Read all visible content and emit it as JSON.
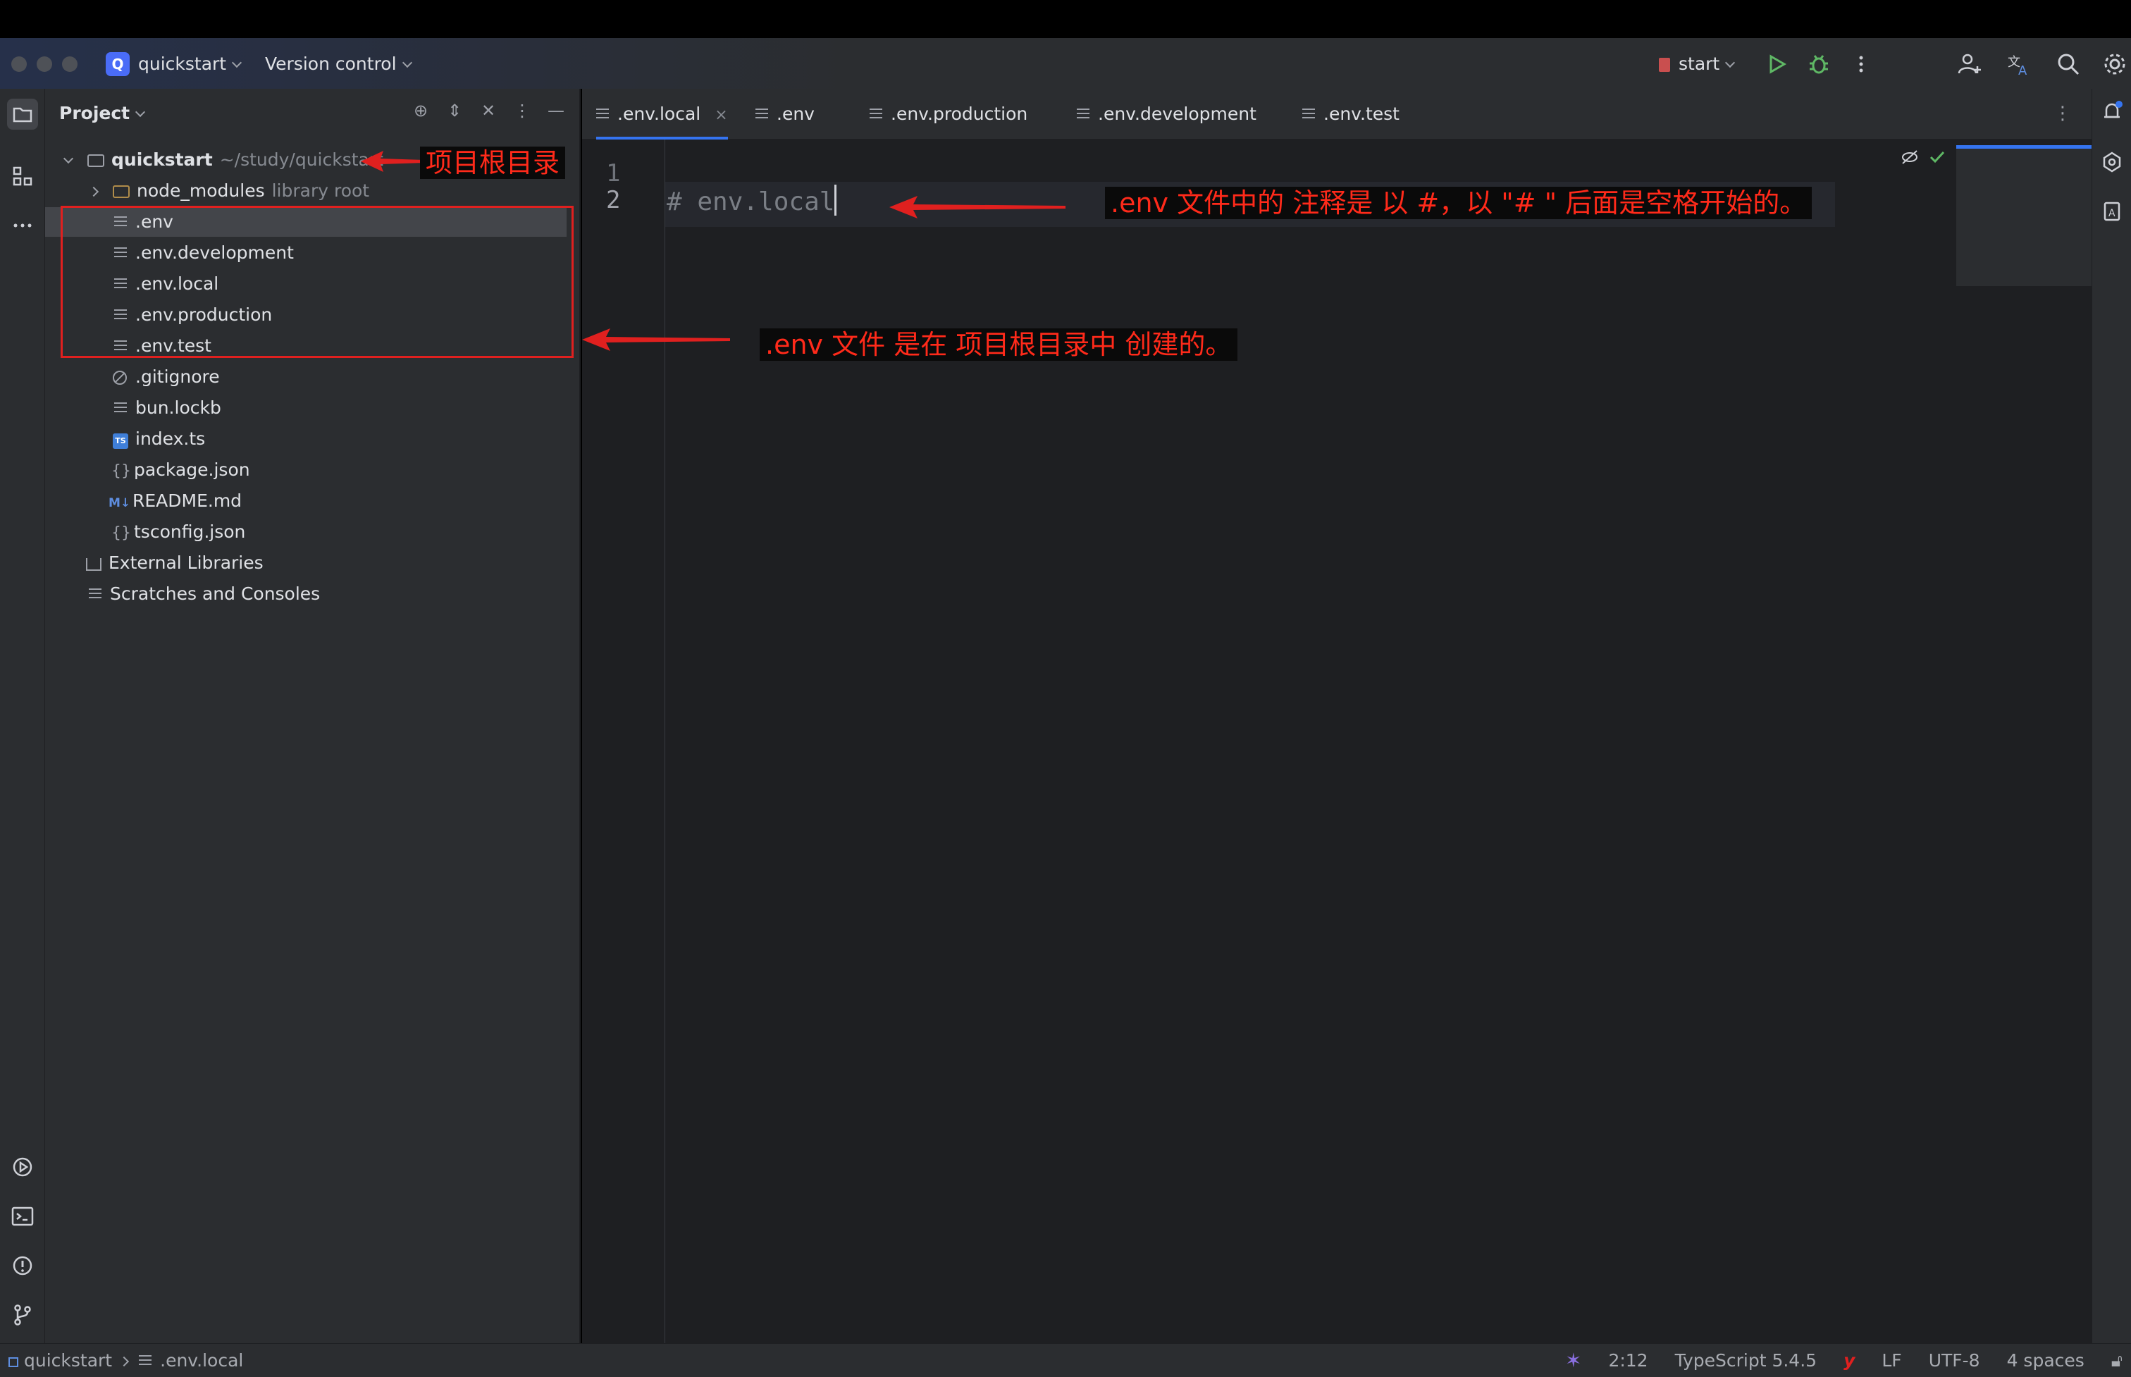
{
  "title_bar": {
    "project_badge": "Q",
    "project_name": "quickstart",
    "vcs_label": "Version control",
    "run_config": "start"
  },
  "project_panel": {
    "header": "Project",
    "tree": [
      {
        "label": "quickstart",
        "hint": "~/study/quickstart"
      },
      {
        "label": "node_modules",
        "hint": "library root"
      },
      {
        "label": ".env"
      },
      {
        "label": ".env.development"
      },
      {
        "label": ".env.local"
      },
      {
        "label": ".env.production"
      },
      {
        "label": ".env.test"
      },
      {
        "label": ".gitignore"
      },
      {
        "label": "bun.lockb"
      },
      {
        "label": "index.ts",
        "badge": "TS"
      },
      {
        "label": "package.json"
      },
      {
        "label": "README.md",
        "badge": "M↓"
      },
      {
        "label": "tsconfig.json"
      },
      {
        "label": "External Libraries"
      },
      {
        "label": "Scratches and Consoles"
      }
    ]
  },
  "editor": {
    "tabs": [
      {
        "label": ".env.local",
        "active": true
      },
      {
        "label": ".env"
      },
      {
        "label": ".env.production"
      },
      {
        "label": ".env.development"
      },
      {
        "label": ".env.test"
      }
    ],
    "line_numbers": [
      "1",
      "2"
    ],
    "code_line_2": "# env.local"
  },
  "status_bar": {
    "breadcrumb_project": "quickstart",
    "breadcrumb_file": ".env.local",
    "position": "2:12",
    "language": "TypeScript 5.4.5",
    "line_ending": "LF",
    "encoding": "UTF-8",
    "indent": "4 spaces"
  },
  "annotations": {
    "root_label": "项目根目录",
    "comment_label": ".env 文件中的 注释是 以 #，以 \"# \" 后面是空格开始的。",
    "created_label": ".env 文件 是在 项目根目录中 创建的。"
  },
  "colors": {
    "accent": "#3574f0",
    "annotation_red": "#ff2a1a",
    "panel_bg": "#2b2d30",
    "editor_bg": "#1e1f22"
  }
}
